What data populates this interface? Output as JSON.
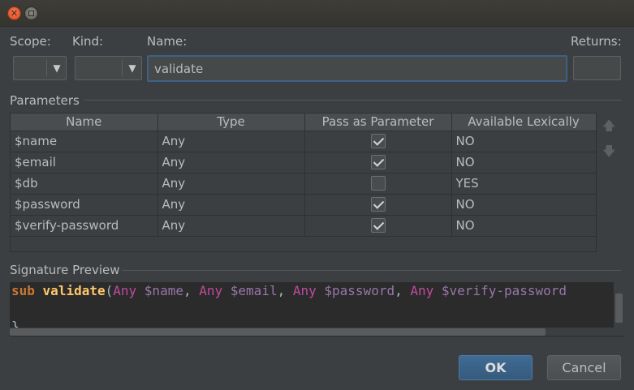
{
  "labels": {
    "scope": "Scope:",
    "kind": "Kind:",
    "name": "Name:",
    "returns": "Returns:",
    "parameters": "Parameters",
    "signature_preview": "Signature Preview"
  },
  "name_value": "validate",
  "table": {
    "headers": [
      "Name",
      "Type",
      "Pass as Parameter",
      "Available Lexically"
    ],
    "rows": [
      {
        "name": "$name",
        "type": "Any",
        "pass": true,
        "lexical": "NO"
      },
      {
        "name": "$email",
        "type": "Any",
        "pass": true,
        "lexical": "NO"
      },
      {
        "name": "$db",
        "type": "Any",
        "pass": false,
        "lexical": "YES"
      },
      {
        "name": "$password",
        "type": "Any",
        "pass": true,
        "lexical": "NO"
      },
      {
        "name": "$verify-password",
        "type": "Any",
        "pass": true,
        "lexical": "NO"
      }
    ]
  },
  "signature": {
    "keyword": "sub",
    "func": "validate",
    "open": "(",
    "params": [
      {
        "type": "Any",
        "var": "$name"
      },
      {
        "type": "Any",
        "var": "$email"
      },
      {
        "type": "Any",
        "var": "$password"
      },
      {
        "type": "Any",
        "var": "$verify-password"
      }
    ],
    "separator": ", ",
    "close_line": "}"
  },
  "buttons": {
    "ok": "OK",
    "cancel": "Cancel"
  },
  "colors": {
    "accent": "#365a7c",
    "keyword": "#cc7832",
    "function": "#ffc66d",
    "type": "#c14b9e",
    "variable": "#9876aa"
  },
  "icons": {
    "close": "close-icon",
    "maximize": "maximize-icon",
    "move_up": "arrow-up-icon",
    "move_down": "arrow-down-icon",
    "dropdown": "chevron-down-icon"
  }
}
